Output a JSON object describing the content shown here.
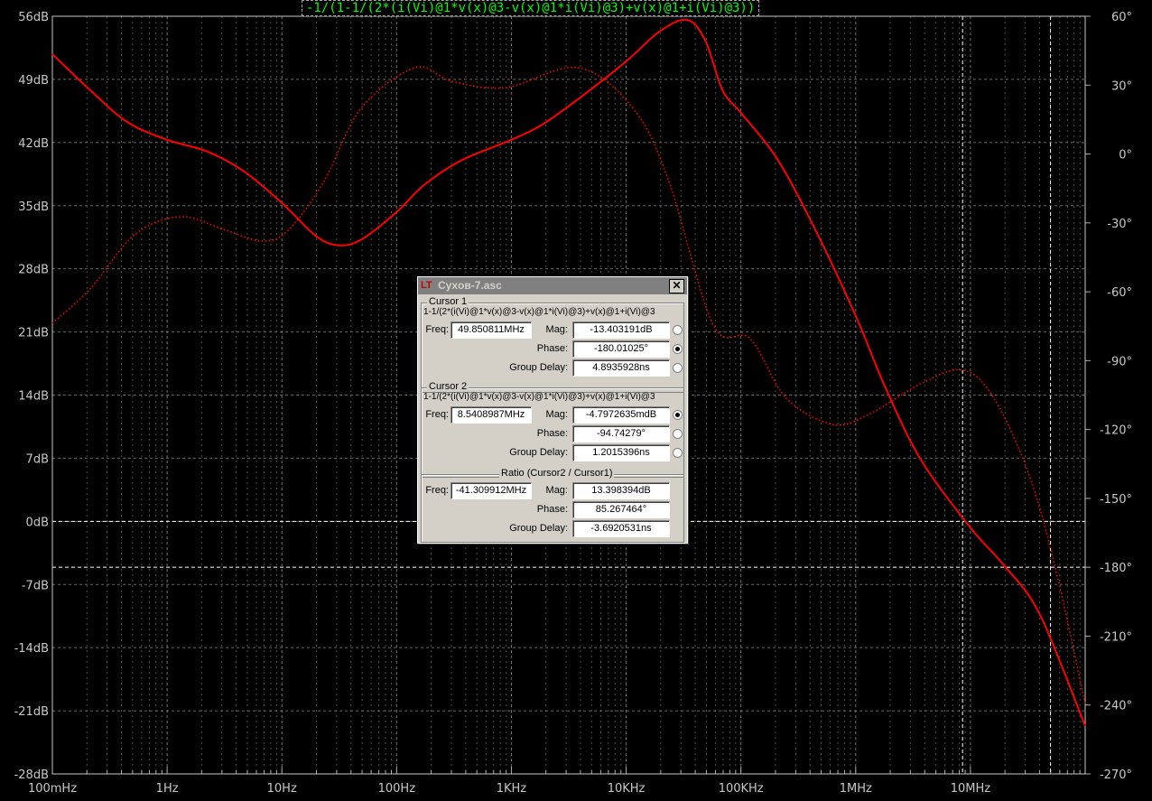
{
  "chart_data": {
    "type": "line",
    "title": "-1/(1-1/(2*(i(Vi)@1*v(x)@3-v(x)@1*i(Vi)@3)+v(x)@1+i(Vi)@3))",
    "xlabel": "",
    "ylabel": "",
    "y2label": "",
    "xscale": "log",
    "xlim": [
      0.1,
      100000000
    ],
    "ylim": [
      -28,
      56
    ],
    "y2lim": [
      -270,
      60
    ],
    "grid": true,
    "x_ticks": [
      {
        "value": 0.1,
        "label": "100mHz"
      },
      {
        "value": 1,
        "label": "1Hz"
      },
      {
        "value": 10,
        "label": "10Hz"
      },
      {
        "value": 100,
        "label": "100Hz"
      },
      {
        "value": 1000,
        "label": "1KHz"
      },
      {
        "value": 10000,
        "label": "10KHz"
      },
      {
        "value": 100000,
        "label": "100KHz"
      },
      {
        "value": 1000000,
        "label": "1MHz"
      },
      {
        "value": 10000000,
        "label": "10MHz"
      }
    ],
    "y_ticks": [
      {
        "value": 56,
        "label": "56dB"
      },
      {
        "value": 49,
        "label": "49dB"
      },
      {
        "value": 42,
        "label": "42dB"
      },
      {
        "value": 35,
        "label": "35dB"
      },
      {
        "value": 28,
        "label": "28dB"
      },
      {
        "value": 21,
        "label": "21dB"
      },
      {
        "value": 14,
        "label": "14dB"
      },
      {
        "value": 7,
        "label": "7dB"
      },
      {
        "value": 0,
        "label": "0dB"
      },
      {
        "value": -7,
        "label": "-7dB"
      },
      {
        "value": -14,
        "label": "-14dB"
      },
      {
        "value": -21,
        "label": "-21dB"
      },
      {
        "value": -28,
        "label": "-28dB"
      }
    ],
    "y2_ticks": [
      {
        "value": 60,
        "label": "60°"
      },
      {
        "value": 30,
        "label": "30°"
      },
      {
        "value": 0,
        "label": "0°"
      },
      {
        "value": -30,
        "label": "-30°"
      },
      {
        "value": -60,
        "label": "-60°"
      },
      {
        "value": -90,
        "label": "-90°"
      },
      {
        "value": -120,
        "label": "-120°"
      },
      {
        "value": -150,
        "label": "-150°"
      },
      {
        "value": -180,
        "label": "-180°"
      },
      {
        "value": -210,
        "label": "-210°"
      },
      {
        "value": -240,
        "label": "-240°"
      },
      {
        "value": -270,
        "label": "-270°"
      }
    ],
    "series": [
      {
        "name": "magnitude",
        "axis": "left",
        "style": "solid",
        "color": "#ff0000",
        "log10_x": [
          -1,
          -0.67,
          -0.35,
          0,
          0.35,
          0.67,
          1,
          1.3,
          1.5,
          1.7,
          2,
          2.24,
          2.56,
          3,
          3.27,
          3.58,
          4,
          4.29,
          4.53,
          4.69,
          4.84,
          5,
          5.31,
          5.63,
          6,
          6.26,
          6.57,
          7,
          7.28,
          7.6,
          8
        ],
        "y": [
          51.8,
          47.8,
          44.3,
          42.3,
          41,
          38.8,
          35.3,
          31.6,
          30.6,
          31.3,
          34.3,
          37.3,
          40,
          42.3,
          44,
          46.8,
          51,
          54.3,
          55.6,
          53.3,
          47.8,
          45.3,
          40.3,
          32.8,
          22.8,
          14.8,
          6.8,
          -0.7,
          -4.7,
          -10.2,
          -22.7
        ]
      },
      {
        "name": "phase",
        "axis": "right",
        "style": "dotted",
        "color": "#ff0000",
        "log10_x": [
          -1,
          -0.67,
          -0.28,
          0.12,
          0.5,
          0.83,
          1.06,
          1.37,
          1.69,
          2.16,
          2.48,
          2.95,
          3.58,
          4.06,
          4.37,
          4.76,
          5.08,
          5.39,
          5.79,
          6.1,
          6.57,
          6.93,
          7.2,
          7.52,
          7.76,
          8
        ],
        "y": [
          -73.7,
          -58.7,
          -35,
          -27.3,
          -33,
          -37.9,
          -33,
          -11.6,
          19.9,
          37.6,
          31.7,
          28.9,
          37.6,
          19.9,
          -11.6,
          -74.5,
          -80.4,
          -106,
          -117.7,
          -113.8,
          -100,
          -94.1,
          -106,
          -141,
          -184.5,
          -239.6
        ]
      }
    ],
    "cursors": [
      {
        "freq": 49850811
      },
      {
        "freq": 8540898.7
      }
    ]
  },
  "dialog": {
    "title": "Cyxов-7.asc",
    "close": "✕",
    "cursor1": {
      "legend": "Cursor 1",
      "expr": "1-1/(2*(i(Vi)@1*v(x)@3-v(x)@1*i(Vi)@3)+v(x)@1+i(Vi)@3",
      "freq_label": "Freq:",
      "freq": "49.850811MHz",
      "mag_label": "Mag:",
      "mag": "-13.403191dB",
      "phase_label": "Phase:",
      "phase": "-180.01025°",
      "gd_label": "Group Delay:",
      "gd": "4.8935928ns"
    },
    "cursor2": {
      "legend": "Cursor 2",
      "expr": "1-1/(2*(i(Vi)@1*v(x)@3-v(x)@1*i(Vi)@3)+v(x)@1+i(Vi)@3",
      "freq_label": "Freq:",
      "freq": "8.5408987MHz",
      "mag_label": "Mag:",
      "mag": "-4.7972635mdB",
      "phase_label": "Phase:",
      "phase": "-94.74279°",
      "gd_label": "Group Delay:",
      "gd": "1.2015396ns"
    },
    "ratio": {
      "legend": "Ratio (Cursor2 / Cursor1)",
      "freq_label": "Freq:",
      "freq": "-41.309912MHz",
      "mag_label": "Mag:",
      "mag": "13.398394dB",
      "phase_label": "Phase:",
      "phase": "85.267464°",
      "gd_label": "Group Delay:",
      "gd": "-3.6920531ns"
    }
  }
}
